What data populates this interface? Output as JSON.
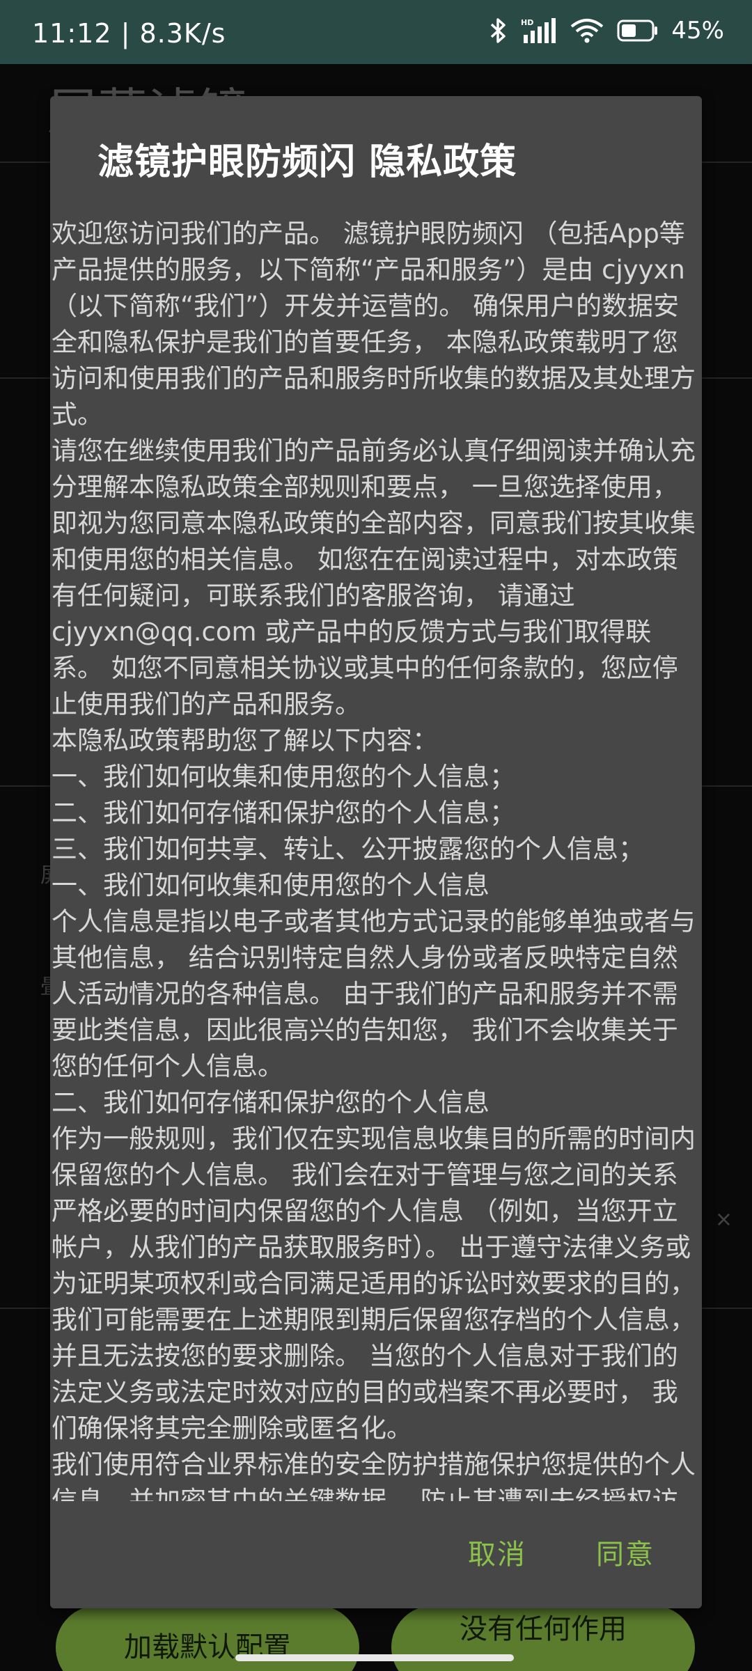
{
  "status_bar": {
    "time": "11:12",
    "speed": "8.3K/s",
    "battery": "45%",
    "icons": [
      "bluetooth-icon",
      "signal-icon",
      "wifi-icon",
      "battery-icon"
    ]
  },
  "background_app": {
    "title": "屏幕滤镜",
    "buttons": {
      "load_default": "加载默认配置",
      "other": "没有任何作用"
    }
  },
  "dialog": {
    "title": "滤镜护眼防频闪 隐私政策",
    "paragraphs": [
      "欢迎您访问我们的产品。 滤镜护眼防频闪 （包括App等产品提供的服务，以下简称“产品和服务”）是由 cjyyxn （以下简称“我们”）开发并运营的。 确保用户的数据安全和隐私保护是我们的首要任务， 本隐私政策载明了您访问和使用我们的产品和服务时所收集的数据及其处理方式。",
      "请您在继续使用我们的产品前务必认真仔细阅读并确认充分理解本隐私政策全部规则和要点， 一旦您选择使用，即视为您同意本隐私政策的全部内容，同意我们按其收集和使用您的相关信息。 如您在在阅读过程中，对本政策有任何疑问，可联系我们的客服咨询， 请通过 cjyyxn@qq.com 或产品中的反馈方式与我们取得联系。 如您不同意相关协议或其中的任何条款的，您应停止使用我们的产品和服务。",
      "本隐私政策帮助您了解以下内容：",
      "一、我们如何收集和使用您的个人信息；",
      "二、我们如何存储和保护您的个人信息；",
      "三、我们如何共享、转让、公开披露您的个人信息；",
      "一、我们如何收集和使用您的个人信息",
      "个人信息是指以电子或者其他方式记录的能够单独或者与其他信息， 结合识别特定自然人身份或者反映特定自然人活动情况的各种信息。 由于我们的产品和服务并不需要此类信息，因此很高兴的告知您， 我们不会收集关于您的任何个人信息。",
      "二、我们如何存储和保护您的个人信息",
      "作为一般规则，我们仅在实现信息收集目的所需的时间内保留您的个人信息。 我们会在对于管理与您之间的关系严格必要的时间内保留您的个人信息 （例如，当您开立帐户，从我们的产品获取服务时）。 出于遵守法律义务或为证明某项权利或合同满足适用的诉讼时效要求的目的， 我们可能需要在上述期限到期后保留您存档的个人信息，并且无法按您的要求删除。 当您的个人信息对于我们的法定义务或法定时效对应的目的或档案不再必要时， 我们确保将其完全删除或匿名化。",
      "我们使用符合业界标准的安全防护措施保护您提供的个人信息，并加密其中的关键数据， 防止其遭到未经授权访问、公开披露、使用、修改、损坏或丢失。"
    ],
    "cancel_label": "取消",
    "agree_label": "同意"
  }
}
